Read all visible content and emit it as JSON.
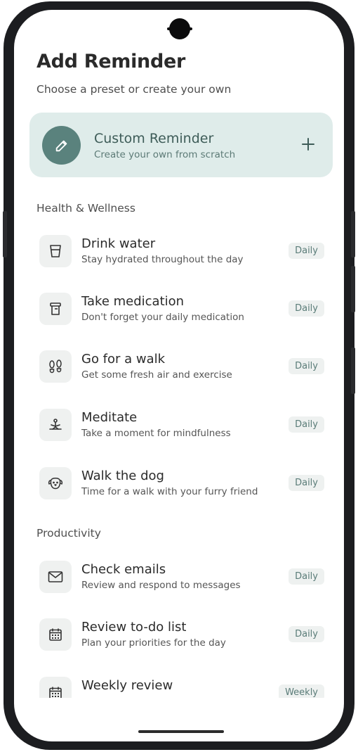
{
  "header": {
    "title": "Add Reminder",
    "subtitle": "Choose a preset or create your own"
  },
  "custom": {
    "title": "Custom Reminder",
    "subtitle": "Create your own from scratch"
  },
  "sections": {
    "health": "Health & Wellness",
    "productivity": "Productivity"
  },
  "items": [
    {
      "title": "Drink water",
      "subtitle": "Stay hydrated throughout the day",
      "badge": "Daily",
      "icon": "glass-icon"
    },
    {
      "title": "Take medication",
      "subtitle": "Don't forget your daily medication",
      "badge": "Daily",
      "icon": "pill-bottle-icon"
    },
    {
      "title": "Go for a walk",
      "subtitle": "Get some fresh air and exercise",
      "badge": "Daily",
      "icon": "footprints-icon"
    },
    {
      "title": "Meditate",
      "subtitle": "Take a moment for mindfulness",
      "badge": "Daily",
      "icon": "meditation-icon"
    },
    {
      "title": "Walk the dog",
      "subtitle": "Time for a walk with your furry friend",
      "badge": "Daily",
      "icon": "dog-icon"
    },
    {
      "title": "Check emails",
      "subtitle": "Review and respond to messages",
      "badge": "Daily",
      "icon": "envelope-icon"
    },
    {
      "title": "Review to-do list",
      "subtitle": "Plan your priorities for the day",
      "badge": "Daily",
      "icon": "calendar-icon"
    },
    {
      "title": "Weekly review",
      "subtitle": "",
      "badge": "Weekly",
      "icon": "calendar-icon"
    }
  ]
}
